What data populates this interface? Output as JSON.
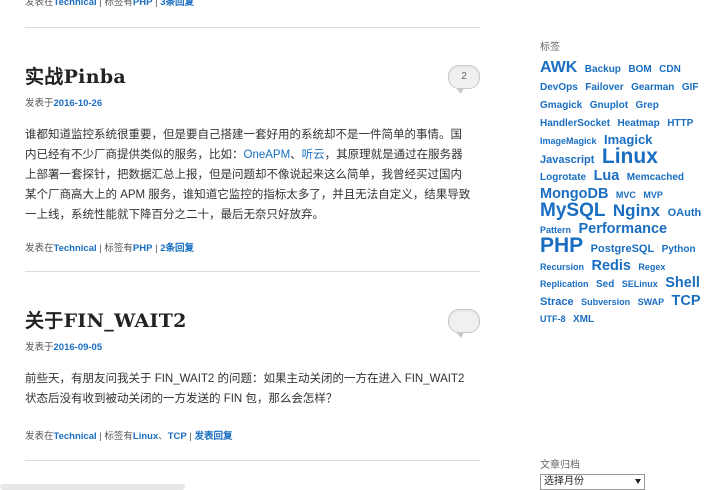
{
  "top_meta": {
    "prefix": "发表在",
    "category": "Technical",
    "sep1": "| 标签有",
    "tag": "PHP",
    "sep2": "|",
    "comments": "3条回复"
  },
  "posts": [
    {
      "title": "实战Pinba",
      "date_prefix": "发表于",
      "date": "2016-10-26",
      "comment_count": "2",
      "excerpt_lines": [
        "谁都知道监控系统很重要，但是要自己搭建一套好用的系统却不是一件简单的事情。国",
        "内已经有不少厂商提供类似的服务，比如：",
        "上部署一套探针，把数据汇总上报，但是问题却不像说起来这么简单，我曾经买过国内",
        "某个厂商高大上的 APM 服务，谁知道它监控的指标太多了，并且无法自定义，结果导致",
        "一上线，系统性能就下降百分之二十，最后无奈只好放弃。"
      ],
      "link1": "OneAPM",
      "link_sep": "、",
      "link2": "听云",
      "line2_rest": "，其原理就是通过在服务器",
      "meta": {
        "prefix": "发表在",
        "category": "Technical",
        "sep1": "| 标签有",
        "tags": "PHP",
        "sep2": "|",
        "comments": "2条回复"
      }
    },
    {
      "title": "关于FIN_WAIT2",
      "date_prefix": "发表于",
      "date": "2016-09-05",
      "excerpt_lines": [
        "前些天，有朋友问我关于 FIN_WAIT2 的问题：如果主动关闭的一方在进入 FIN_WAIT2",
        "状态后没有收到被动关闭的一方发送的 FIN 包，那么会怎样？"
      ],
      "meta": {
        "prefix": "发表在",
        "category": "Technical",
        "sep1": "| 标签有",
        "tag1": "Linux",
        "tag_sep": "、",
        "tag2": "TCP",
        "sep2": "|",
        "comments": "发表回复"
      }
    }
  ],
  "sidebar": {
    "tags_title": "标签",
    "tags": [
      {
        "t": "AWK",
        "s": "t16"
      },
      {
        "t": "Backup",
        "s": "t9"
      },
      {
        "t": "BOM",
        "s": "t9"
      },
      {
        "t": "CDN",
        "s": "t9"
      },
      {
        "t": "DevOps",
        "s": "t9"
      },
      {
        "t": "Failover",
        "s": "t9"
      },
      {
        "t": "Gearman",
        "s": "t9"
      },
      {
        "t": "GIF",
        "s": "t9"
      },
      {
        "t": "Gmagick",
        "s": "t9"
      },
      {
        "t": "Gnuplot",
        "s": "t9"
      },
      {
        "t": "Grep",
        "s": "t9"
      },
      {
        "t": "HandlerSocket",
        "s": "t9"
      },
      {
        "t": "Heatmap",
        "s": "t9"
      },
      {
        "t": "HTTP",
        "s": "t9"
      },
      {
        "t": "ImageMagick",
        "s": "t8"
      },
      {
        "t": "Imagick",
        "s": "t12"
      },
      {
        "t": "Javascript",
        "s": "t10"
      },
      {
        "t": "Linux",
        "s": "t21"
      },
      {
        "t": "Logrotate",
        "s": "t9"
      },
      {
        "t": "Lua",
        "s": "t14"
      },
      {
        "t": "Memcached",
        "s": "t9"
      },
      {
        "t": "MongoDB",
        "s": "t14"
      },
      {
        "t": "MVC",
        "s": "t8"
      },
      {
        "t": "MVP",
        "s": "t8"
      },
      {
        "t": "MySQL",
        "s": "t19"
      },
      {
        "t": "Nginx",
        "s": "t17"
      },
      {
        "t": "OAuth",
        "s": "t10"
      },
      {
        "t": "Pattern",
        "s": "t8"
      },
      {
        "t": "Performance",
        "s": "t14"
      },
      {
        "t": "PHP",
        "s": "t21"
      },
      {
        "t": "PostgreSQL",
        "s": "t10"
      },
      {
        "t": "Python",
        "s": "t9"
      },
      {
        "t": "Recursion",
        "s": "t8"
      },
      {
        "t": "Redis",
        "s": "t14"
      },
      {
        "t": "Regex",
        "s": "t8"
      },
      {
        "t": "Replication",
        "s": "t8"
      },
      {
        "t": "Sed",
        "s": "t9"
      },
      {
        "t": "SELinux",
        "s": "t8"
      },
      {
        "t": "Shell",
        "s": "t14"
      },
      {
        "t": "Strace",
        "s": "t10"
      },
      {
        "t": "Subversion",
        "s": "t8"
      },
      {
        "t": "SWAP",
        "s": "t8"
      },
      {
        "t": "TCP",
        "s": "t14"
      },
      {
        "t": "UTF-8",
        "s": "t8"
      },
      {
        "t": "XML",
        "s": "t9"
      }
    ],
    "archive_title": "文章归档",
    "archive_select": "选择月份"
  }
}
